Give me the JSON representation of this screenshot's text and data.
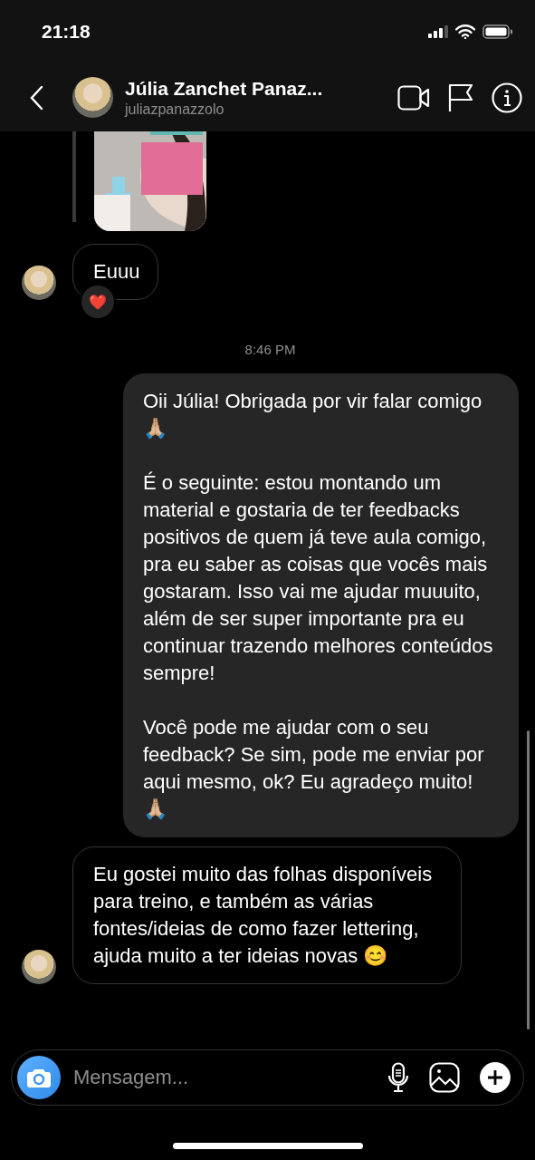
{
  "status_bar": {
    "time": "21:18"
  },
  "header": {
    "name": "Júlia Zanchet Panaz...",
    "username": "juliazpanazzolo"
  },
  "messages": [
    {
      "kind": "received",
      "paragraphs": [
        "Euuu"
      ],
      "reaction": "❤️"
    },
    {
      "kind": "timestamp",
      "paragraphs": [
        "8:46 PM"
      ]
    },
    {
      "kind": "sent",
      "paragraphs": [
        "Oii Júlia! Obrigada por vir falar comigo 🙏🏼",
        "É o seguinte: estou montando um material e gostaria de ter feedbacks positivos de quem já teve aula comigo, pra eu saber as coisas que vocês mais gostaram. Isso vai me ajudar muuuito, além de ser super importante pra eu continuar trazendo melhores conteúdos sempre!",
        "Você pode me ajudar com o seu feedback? Se sim, pode me enviar por aqui mesmo, ok? Eu agradeço muito! 🙏🏼"
      ]
    },
    {
      "kind": "received",
      "paragraphs": [
        "Eu gostei muito das folhas disponíveis para treino, e também as várias fontes/ideias de como fazer lettering, ajuda muito a ter ideias novas 😊"
      ]
    }
  ],
  "composer": {
    "placeholder": "Mensagem..."
  }
}
